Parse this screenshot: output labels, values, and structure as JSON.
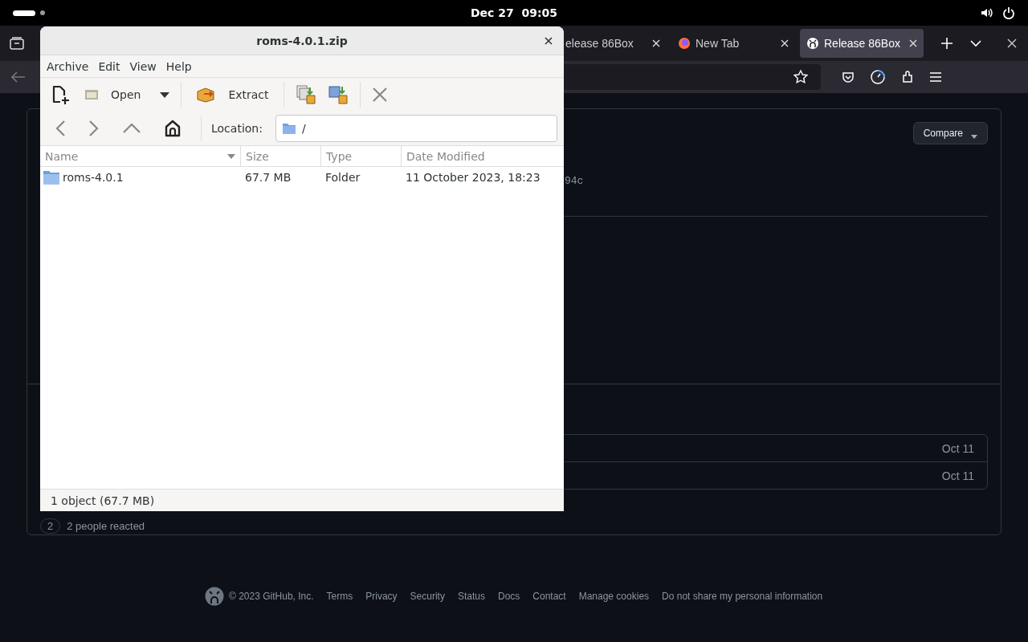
{
  "system_bar": {
    "clock": "Dec 27  09:05"
  },
  "browser": {
    "tabs": [
      {
        "title": "elease 86Box",
        "selected": false,
        "kind": "plain"
      },
      {
        "title": "New Tab",
        "selected": false,
        "kind": "fox"
      },
      {
        "title": "Release 86Box",
        "selected": true,
        "kind": "cat"
      }
    ]
  },
  "page": {
    "compare_button": "Compare",
    "commit_hash": "94c",
    "assets": [
      {
        "date": "Oct 11"
      },
      {
        "date": "Oct 11"
      }
    ],
    "reactions": {
      "count": "2",
      "label": "2 people reacted"
    },
    "footer": {
      "copyright": "© 2023 GitHub, Inc.",
      "links": [
        "Terms",
        "Privacy",
        "Security",
        "Status",
        "Docs",
        "Contact",
        "Manage cookies",
        "Do not share my personal information"
      ]
    }
  },
  "archive_window": {
    "title": "roms-4.0.1.zip",
    "menu": [
      "Archive",
      "Edit",
      "View",
      "Help"
    ],
    "toolbar": {
      "open": "Open",
      "extract": "Extract"
    },
    "location_label": "Location:",
    "location": "/",
    "columns": [
      "Name",
      "Size",
      "Type",
      "Date Modified"
    ],
    "rows": [
      {
        "name": "roms-4.0.1",
        "size": "67.7 MB",
        "type": "Folder",
        "modified": "11 October 2023, 18:23",
        "kind": "folder"
      }
    ],
    "status": "1 object (67.7 MB)"
  }
}
